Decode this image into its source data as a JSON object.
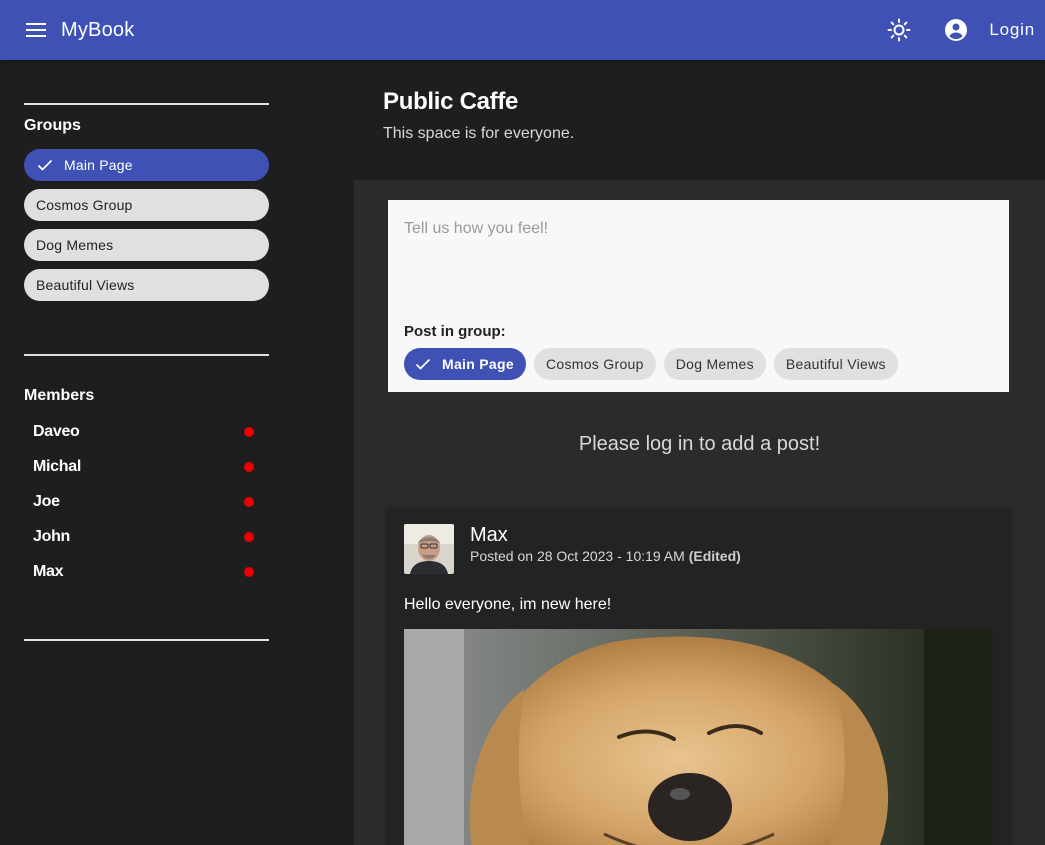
{
  "app": {
    "title": "MyBook",
    "login_label": "Login",
    "accent_color": "#3f51b5"
  },
  "icons": {
    "menu": "menu-icon",
    "theme": "sun-icon",
    "account": "account-circle-icon",
    "check": "check-icon"
  },
  "sidebar": {
    "groups_title": "Groups",
    "groups": [
      {
        "label": "Main Page",
        "selected": true
      },
      {
        "label": "Cosmos Group",
        "selected": false
      },
      {
        "label": "Dog Memes",
        "selected": false
      },
      {
        "label": "Beautiful Views",
        "selected": false
      }
    ],
    "members_title": "Members",
    "members": [
      {
        "name": "Daveo",
        "status_color": "#ee0000"
      },
      {
        "name": "Michal",
        "status_color": "#ee0000"
      },
      {
        "name": "Joe",
        "status_color": "#ee0000"
      },
      {
        "name": "John",
        "status_color": "#ee0000"
      },
      {
        "name": "Max",
        "status_color": "#ee0000"
      }
    ]
  },
  "header": {
    "title": "Public Caffe",
    "subtitle": "This space is for everyone."
  },
  "composer": {
    "placeholder": "Tell us how you feel!",
    "group_label": "Post in group:",
    "chips": [
      {
        "label": "Main Page",
        "selected": true
      },
      {
        "label": "Cosmos Group",
        "selected": false
      },
      {
        "label": "Dog Memes",
        "selected": false
      },
      {
        "label": "Beautiful Views",
        "selected": false
      }
    ]
  },
  "login_notice": "Please log in to add a post!",
  "post": {
    "author": "Max",
    "posted_on": "Posted on 28 Oct 2023 - 10:19 AM",
    "edited_label": "(Edited)",
    "text": "Hello everyone, im new here!"
  }
}
